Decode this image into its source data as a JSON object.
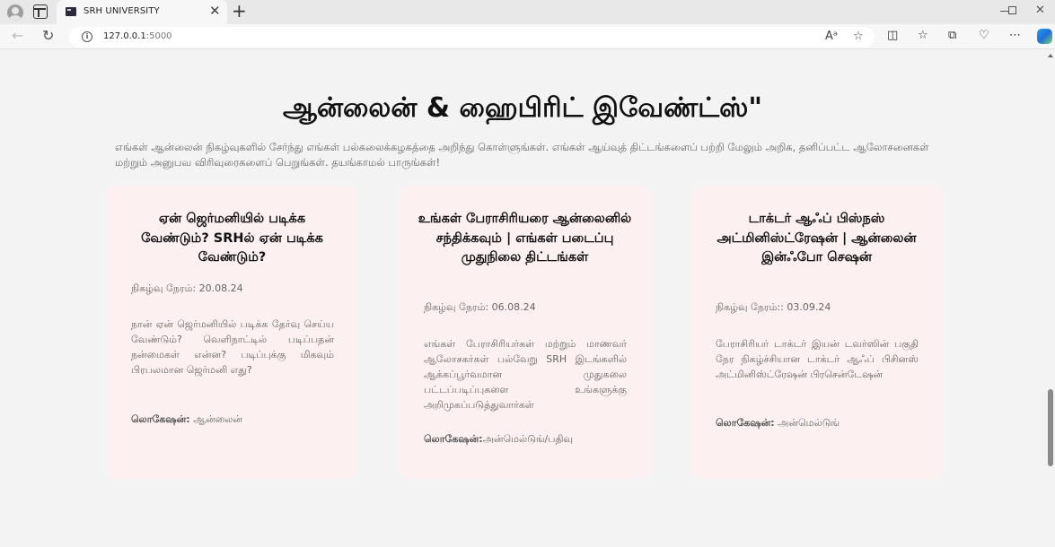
{
  "browser": {
    "tab_title": "SRH UNIVERSITY",
    "url_host": "127.0.0.1",
    "url_port": ":5000"
  },
  "page": {
    "heading": "ஆன்லைன் & ஹைபிரிட் இவேண்ட்ஸ்\"",
    "intro": "எங்கள் ஆன்லைன் நிகழ்வுகளில் சேர்ந்து எங்கள் பல்கலைக்கழகத்தை அறிந்து கொள்ளுங்கள். எங்கள் ஆய்வுத் திட்டங்களைப் பற்றி மேலும் அறிக, தனிப்பட்ட ஆலோசனைகள் மற்றும் அனுபவ விரிவுரைகளைப் பெறுங்கள். தயங்காமல் பாருங்கள்!",
    "cards": [
      {
        "title": "ஏன் ஜெர்மனியில் படிக்க வேண்டும்? SRHல் ஏன் படிக்க வேண்டும்?",
        "time": "நிகழ்வு நேரம்: 20.08.24",
        "description": "நான் ஏன் ஜெர்மனியில் படிக்க தேர்வு செய்ய வேண்டும்? வெளிநாட்டில் படிப்பதன் நன்மைகள் என்ன? படிப்புக்கு மிகவும் பிரபலமான ஜெர்மனி எது?",
        "location_label": "லொகேஷன்:",
        "location_value": " ஆன்லைன்"
      },
      {
        "title": "உங்கள் பேராசிரியரை ஆன்லைனில் சந்திக்கவும் | எங்கள் படைப்பு முதுநிலை திட்டங்கள்",
        "time": "நிகழ்வு நேரம்: 06.08.24",
        "description": "எங்கள் பேராசிரியர்கள் மற்றும் மாணவர் ஆலோசகர்கள் பல்வேறு SRH இடங்களில் ஆக்கப்பூர்வமான முதுகலை பட்டப்படிப்புகளை உங்களுக்கு அறிமுகப்படுத்துவார்கள்",
        "location_label": "லொகேஷன்:",
        "location_value": "அன்மெல்டுங்/பதிவு"
      },
      {
        "title": "டாக்டர் ஆஃப் பிஸ்நஸ் அட்மினிஸ்ட்ரேஷன் | ஆன்லைன் இன்ஃபோ செஷன்",
        "time": "நிகழ்வு நேரம்:: 03.09.24",
        "description": "பேராசிரியர் டாக்டர் இயன் டவர்ஸின் பகுதி நேர நிகழ்ச்சியான டாக்டர் ஆஃப் பிசினஸ் அட்மினிஸ்ட்ரேஷன் பிரசென்டேஷன்",
        "location_label": "லொகேஷன்:",
        "location_value": " அன்மெல்டுங்"
      }
    ]
  }
}
